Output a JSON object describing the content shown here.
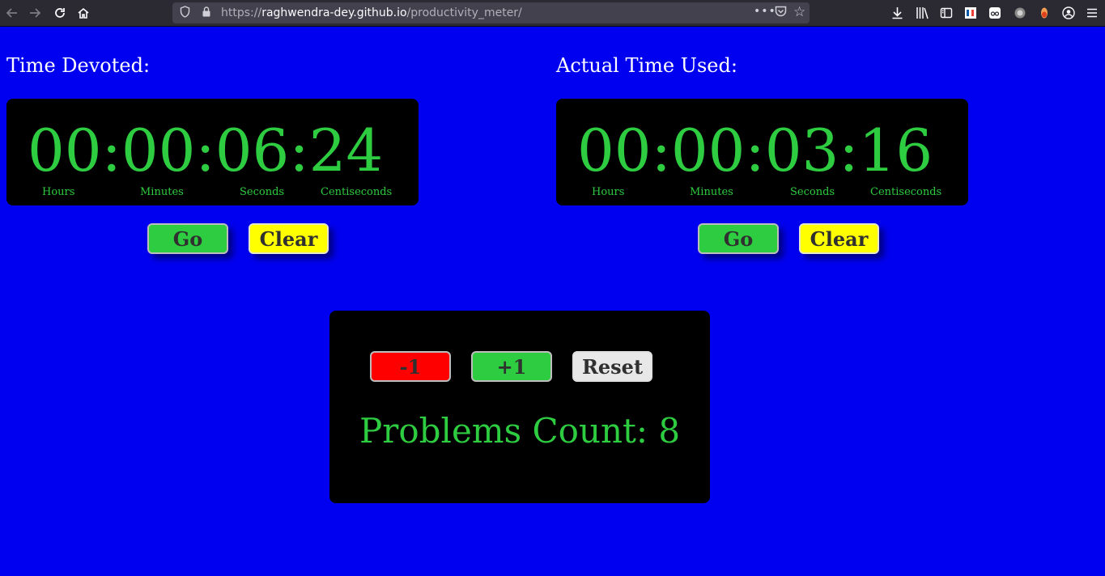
{
  "browser": {
    "url_scheme": "https://",
    "url_host": "raghwendra-dey.github.io",
    "url_path": "/productivity_meter/",
    "icons": {
      "back": "back-arrow-icon",
      "forward": "forward-arrow-icon",
      "reload": "reload-icon",
      "home": "home-icon"
    }
  },
  "timers": {
    "devoted": {
      "title": "Time Devoted:",
      "display": "00:00:06:24",
      "units": [
        "Hours",
        "Minutes",
        "Seconds",
        "Centiseconds"
      ],
      "go_label": "Go",
      "clear_label": "Clear"
    },
    "actual": {
      "title": "Actual Time Used:",
      "display": "00:00:03:16",
      "units": [
        "Hours",
        "Minutes",
        "Seconds",
        "Centiseconds"
      ],
      "go_label": "Go",
      "clear_label": "Clear"
    }
  },
  "counter": {
    "minus_label": "-1",
    "plus_label": "+1",
    "reset_label": "Reset",
    "count_text": "Problems Count: 8"
  },
  "colors": {
    "page_bg": "#0000f0",
    "accent_green": "#2ecc40",
    "clear_yellow": "#ffff00",
    "minus_red": "#ff0000"
  }
}
